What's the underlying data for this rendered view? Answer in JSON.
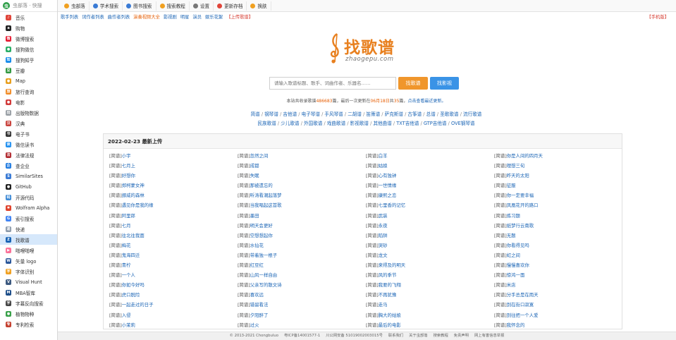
{
  "brand": {
    "title": "虫部落 · 快搜",
    "logo_glyph": "虫"
  },
  "sidebar": {
    "items": [
      {
        "label": "音乐",
        "icon": "music-icon",
        "color": "#e0453a",
        "glyph": "♪"
      },
      {
        "label": "购物",
        "icon": "amazon-icon",
        "color": "#222222",
        "glyph": "a"
      },
      {
        "label": "微博搜索",
        "icon": "weibo-icon",
        "color": "#e6162d",
        "glyph": "微"
      },
      {
        "label": "搜狗微信",
        "icon": "wechat-icon",
        "color": "#2aae67",
        "glyph": "●"
      },
      {
        "label": "搜狗知乎",
        "icon": "zhihu-icon",
        "color": "#0f88eb",
        "glyph": "知"
      },
      {
        "label": "豆瓣",
        "icon": "douban-icon",
        "color": "#2e963d",
        "glyph": "豆"
      },
      {
        "label": "Map",
        "icon": "map-pin-icon",
        "color": "#e8a020",
        "glyph": "●"
      },
      {
        "label": "旅行查询",
        "icon": "travel-icon",
        "color": "#f08a24",
        "glyph": "旅"
      },
      {
        "label": "电影",
        "icon": "film-icon",
        "color": "#d23b3b",
        "glyph": "●"
      },
      {
        "label": "出版物数据",
        "icon": "publication-icon",
        "color": "#9aa0a6",
        "glyph": "出"
      },
      {
        "label": "汉典",
        "icon": "handian-icon",
        "color": "#c8403a",
        "glyph": "汉"
      },
      {
        "label": "电子书",
        "icon": "ebook-icon",
        "color": "#333333",
        "glyph": "书"
      },
      {
        "label": "微信读书",
        "icon": "weread-icon",
        "color": "#1f8ff0",
        "glyph": "读"
      },
      {
        "label": "法律法规",
        "icon": "law-icon",
        "color": "#b0282e",
        "glyph": "法"
      },
      {
        "label": "查企业",
        "icon": "company-icon",
        "color": "#1f7ae0",
        "glyph": "企"
      },
      {
        "label": "SimilarSites",
        "icon": "similarsites-icon",
        "color": "#3a7bd5",
        "glyph": "S"
      },
      {
        "label": "GitHub",
        "icon": "github-icon",
        "color": "#222222",
        "glyph": "●"
      },
      {
        "label": "开源代码",
        "icon": "code-icon",
        "color": "#3e8ad6",
        "glyph": "码"
      },
      {
        "label": "Wolfram Alpha",
        "icon": "wolfram-icon",
        "color": "#e0432d",
        "glyph": "✱"
      },
      {
        "label": "索引搜索",
        "icon": "google-icon",
        "color": "#4285f4",
        "glyph": "G"
      },
      {
        "label": "快递",
        "icon": "express-icon",
        "color": "#8a99aa",
        "glyph": "递"
      },
      {
        "label": "找歌谱",
        "icon": "zhaogepu-icon",
        "color": "#1a64b5",
        "glyph": "Z"
      },
      {
        "label": "啪哩啪哩",
        "icon": "bilibili-icon",
        "color": "#fb7299",
        "glyph": "▶"
      },
      {
        "label": "矢量 logo",
        "icon": "vector-logo-icon",
        "color": "#2b579a",
        "glyph": "W"
      },
      {
        "label": "字体识别",
        "icon": "font-recognition-icon",
        "color": "#f0a020",
        "glyph": "字"
      },
      {
        "label": "Visual Hunt",
        "icon": "visual-hunt-icon",
        "color": "#3d5a80",
        "glyph": "V"
      },
      {
        "label": "MBA智库",
        "icon": "mba-icon",
        "color": "#1d4e89",
        "glyph": "M"
      },
      {
        "label": "字幕反向搜索",
        "icon": "subtitle-icon",
        "color": "#444444",
        "glyph": "字"
      },
      {
        "label": "植物物种",
        "icon": "plant-icon",
        "color": "#3aa14a",
        "glyph": "●"
      },
      {
        "label": "专利检索",
        "icon": "patent-icon",
        "color": "#c4402f",
        "glyph": "专"
      }
    ],
    "active_index": 21
  },
  "topbar": {
    "items": [
      {
        "label": "虫部落",
        "icon": "bug-icon",
        "color": "#f0a020"
      },
      {
        "label": "学术搜索",
        "icon": "graduation-cap-icon",
        "color": "#3a7bd5"
      },
      {
        "label": "图书搜索",
        "icon": "book-icon",
        "color": "#3a7bd5"
      },
      {
        "label": "搜索教程",
        "icon": "tutorial-icon",
        "color": "#f0a020"
      },
      {
        "label": "设置",
        "icon": "gear-icon",
        "color": "#777777"
      },
      {
        "label": "更新存档",
        "icon": "refresh-icon",
        "color": "#e0453a"
      },
      {
        "label": "换肤",
        "icon": "palette-icon",
        "color": "#f0a020"
      }
    ]
  },
  "nav": {
    "links": [
      {
        "label": "歌手列表",
        "style": "link"
      },
      {
        "label": "词作者列表",
        "style": "link"
      },
      {
        "label": "曲作者列表",
        "style": "link"
      },
      {
        "label": "演奏视频大全",
        "style": "hl"
      },
      {
        "label": "影视剧",
        "style": "link"
      },
      {
        "label": "明星",
        "style": "link"
      },
      {
        "label": "演员",
        "style": "link"
      },
      {
        "label": "娱乐花絮",
        "style": "link"
      },
      {
        "label": "【上传歌谱】",
        "style": "red"
      }
    ],
    "mobile": "【手机版】"
  },
  "site": {
    "name": "找歌谱",
    "domain": "zhaogepu.com"
  },
  "search": {
    "placeholder": "请输入歌谱标题、歌手、词曲作者、乐器名……",
    "btn_song": "找歌谱",
    "btn_video": "找影视"
  },
  "stats": {
    "p1": "本站共收录歌谱",
    "count": "486683",
    "p2": "篇，最后一次更新在",
    "date": "06月18日",
    "p3": "共",
    "num": "35",
    "p4": "篇，",
    "link": "点击查看最近更新。"
  },
  "categories": {
    "row1": [
      "简谱",
      "钢琴谱",
      "吉他谱",
      "电子琴谱",
      "手风琴谱",
      "二胡谱",
      "笛箫谱",
      "萨克斯谱",
      "古筝谱",
      "总谱",
      "圣歌歌谱",
      "流行歌谱"
    ],
    "row2": [
      "民族歌谱",
      "少儿歌谱",
      "外国歌谱",
      "戏曲歌谱",
      "影视歌谱",
      "其他曲谱",
      "TXT吉他谱",
      "GTP吉他谱",
      "OVE钢琴谱"
    ]
  },
  "uploads": {
    "title": "2022-02-23 最新上传",
    "tag": "[简谱]",
    "songs": [
      "小宇",
      "忽然之间",
      "白羊",
      "你是人间的四月天",
      "七月上",
      "成都",
      "姑娘",
      "理想三旬",
      "好想你",
      "失眠",
      "心有独钟",
      "昨天的太阳",
      "郑柯蒙女神",
      "那被遗忘的",
      "一世情缘",
      "征服",
      "挪威的森林",
      "听涛看潮起落梦",
      "康熙之恋",
      "你一定要幸福",
      "遇见你是我的缘",
      "当我唱起这首歌",
      "七里香的记忆",
      "凤凰花开的路口",
      "阿里郎",
      "墨田",
      "武装",
      "炼习题",
      "七月",
      "明天会更好",
      "永夜",
      "纸梦行云南歌",
      "往北往我面",
      "空想想起你",
      "陷阱",
      "无题",
      "梅花",
      "水仙花",
      "哭砂",
      "你看得见吗",
      "鬼海四迁",
      "带着独一根子",
      "龙文",
      "虹之间",
      "青柠",
      "红豆红",
      "来得及的明天",
      "慢慢喜欢你",
      "一个人",
      "山风一样自由",
      "风的季节",
      "惊鸿一面",
      "你如今好吗",
      "父亲写的散文诗",
      "我要的飞翔",
      "米店",
      "虎口脱险",
      "喜欢远",
      "不再犹豫",
      "分手总是在雨天",
      "一起走过的日子",
      "错留看法",
      "走马",
      "到在街口寂寞",
      "入侵",
      "夕阳醉了",
      "胸大的姑娘",
      "到往把一个人爱",
      "小茉莉",
      "过火",
      "最后的电影",
      "我怀念的"
    ]
  },
  "footer": {
    "items": [
      "© 2013-2021 Chongbuluo",
      "粤ICP备14001577-1",
      "川公网安备 51019002003015号",
      "联系我们",
      "关于虫部落",
      "搜索教程",
      "免责声明",
      "网上有害信息举报"
    ]
  },
  "colors": {
    "link": "#1a64b5",
    "accent": "#f0962c",
    "video": "#3a93e6",
    "highlight": "#e65c00"
  }
}
